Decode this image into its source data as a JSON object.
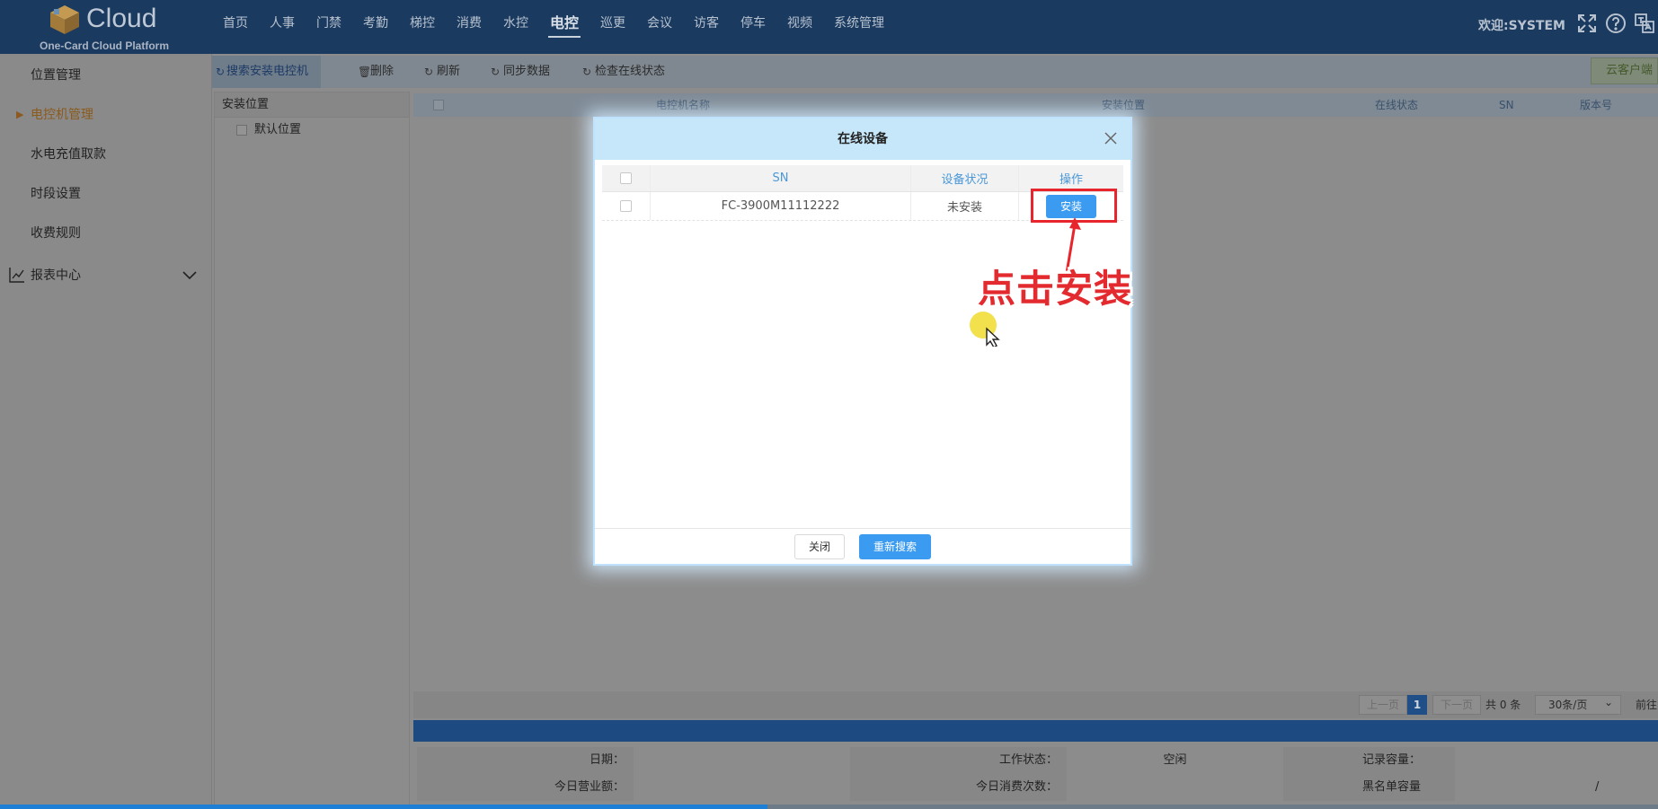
{
  "header": {
    "logo_text": "Cloud",
    "logo_subtitle": "One-Card Cloud Platform",
    "nav": [
      {
        "label": "首页",
        "active": false
      },
      {
        "label": "人事",
        "active": false
      },
      {
        "label": "门禁",
        "active": false
      },
      {
        "label": "考勤",
        "active": false
      },
      {
        "label": "梯控",
        "active": false
      },
      {
        "label": "消费",
        "active": false
      },
      {
        "label": "水控",
        "active": false
      },
      {
        "label": "电控",
        "active": true
      },
      {
        "label": "巡更",
        "active": false
      },
      {
        "label": "会议",
        "active": false
      },
      {
        "label": "访客",
        "active": false
      },
      {
        "label": "停车",
        "active": false
      },
      {
        "label": "视频",
        "active": false
      },
      {
        "label": "系统管理",
        "active": false
      }
    ],
    "welcome": "欢迎:SYSTEM",
    "icons": [
      "fullscreen-icon",
      "help-icon",
      "language-icon"
    ]
  },
  "sidebar": {
    "items": [
      {
        "label": "位置管理",
        "active": false
      },
      {
        "label": "电控机管理",
        "active": true
      },
      {
        "label": "水电充值取款",
        "active": false
      },
      {
        "label": "时段设置",
        "active": false
      },
      {
        "label": "收费规则",
        "active": false
      }
    ],
    "report": {
      "label": "报表中心",
      "icon": "chart-icon"
    }
  },
  "toolbar": {
    "buttons": [
      {
        "label": "搜索安装电控机",
        "icon": "refresh-icon"
      },
      {
        "label": "删除",
        "icon": "trash-icon"
      },
      {
        "label": "刷新",
        "icon": "refresh-icon"
      },
      {
        "label": "同步数据",
        "icon": "refresh-icon"
      },
      {
        "label": "检查在线状态",
        "icon": "refresh-icon"
      }
    ],
    "right_button": "云客户端"
  },
  "tree": {
    "title": "安装位置",
    "nodes": [
      "默认位置"
    ]
  },
  "main_table": {
    "columns": [
      "电控机名称",
      "安装位置",
      "在线状态",
      "SN",
      "版本号"
    ]
  },
  "pagination": {
    "prev": "上一页",
    "current": "1",
    "next": "下一页",
    "total": "共 0 条",
    "page_size": "30条/页",
    "goto": "前往"
  },
  "info": {
    "row1": [
      {
        "label": "日期：",
        "value": ""
      },
      {
        "label": "工作状态：",
        "value": "空闲"
      },
      {
        "label": "记录容量：",
        "value": ""
      }
    ],
    "row2": [
      {
        "label": "今日营业额：",
        "value": ""
      },
      {
        "label": "今日消费次数：",
        "value": ""
      },
      {
        "label": "黑名单容量",
        "value": "/"
      }
    ]
  },
  "progress": {
    "fraction": 0.463,
    "color": "#1e7fd6"
  },
  "modal": {
    "title": "在线设备",
    "columns": {
      "sn": "SN",
      "status": "设备状况",
      "action": "操作"
    },
    "rows": [
      {
        "sn": "FC-3900M11112222",
        "status": "未安装",
        "action_label": "安装"
      }
    ],
    "annotation": "点击安装",
    "annotation_color": "#e32a2e",
    "close_label": "关闭",
    "research_label": "重新搜索"
  },
  "colors": {
    "header_bg": "#1a3a60",
    "accent_blue": "#3a9bf0",
    "modal_header": "#c6e7fa"
  }
}
